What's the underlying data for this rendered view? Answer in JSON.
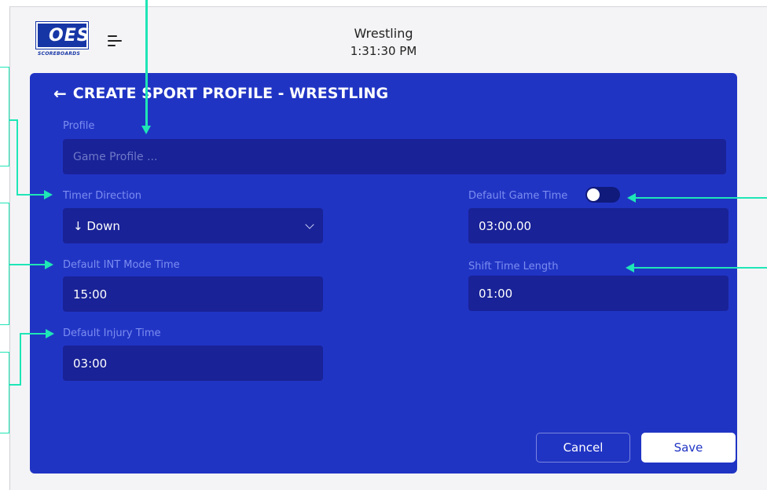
{
  "app": {
    "logo_text": "OES",
    "logo_subtext": "SCOREBOARDS",
    "sport": "Wrestling",
    "time": "1:31:30 PM"
  },
  "page": {
    "back_icon": "←",
    "title": "CREATE SPORT PROFILE - WRESTLING"
  },
  "form": {
    "profile": {
      "label": "Profile",
      "value": "",
      "placeholder": "Game Profile ..."
    },
    "timer_direction": {
      "label": "Timer Direction",
      "value": "↓ Down"
    },
    "default_int_mode_time": {
      "label": "Default INT Mode Time",
      "value": "15:00"
    },
    "default_injury_time": {
      "label": "Default Injury Time",
      "value": "03:00"
    },
    "default_game_time": {
      "label": "Default Game Time",
      "value": "03:00.00"
    },
    "shift_time_length": {
      "label": "Shift Time Length",
      "value": "01:00",
      "enabled": false
    }
  },
  "actions": {
    "cancel": "Cancel",
    "save": "Save"
  },
  "colors": {
    "panel": "#2034c4",
    "field": "#192296",
    "label": "#7c8df0",
    "annotation": "#1ee6b6",
    "brand": "#1736a6"
  },
  "icons": {
    "menu": "menu-icon",
    "back": "back-arrow-icon",
    "dropdown": "chevron-down-icon"
  }
}
